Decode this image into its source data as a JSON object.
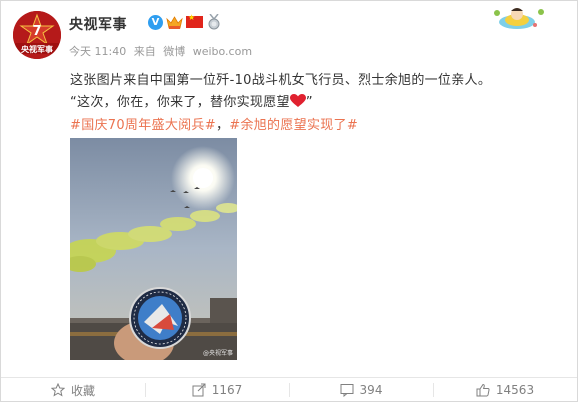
{
  "post": {
    "username": "央视军事",
    "verified_icon": "verified-v-icon",
    "avatar_text": "央视军事",
    "meta": {
      "time": "今天 11:40",
      "from": "来自",
      "client": "微博",
      "site": "weibo.com"
    },
    "text_line1": "这张图片来自中国第一位歼-10战斗机女飞行员、烈士余旭的一位亲人。",
    "text_line2_pre": "“这次，你在，你来了，替你实现愿望",
    "text_line2_post": "”",
    "tags": [
      "#国庆70周年盛大阅兵#",
      "#余旭的愿望实现了#"
    ],
    "tag_separator": "，",
    "image_watermark": "@央视军事"
  },
  "actions": [
    {
      "icon": "star-favorite-icon",
      "label": "收藏"
    },
    {
      "icon": "share-forward-icon",
      "label": "1167"
    },
    {
      "icon": "comment-icon",
      "label": "394"
    },
    {
      "icon": "thumbs-up-icon",
      "label": "14563"
    }
  ],
  "colors": {
    "tag_orange": "#eb7350",
    "meta_gray": "#999999",
    "avatar_red": "#b51a1a",
    "heart_red": "#e0212f"
  }
}
